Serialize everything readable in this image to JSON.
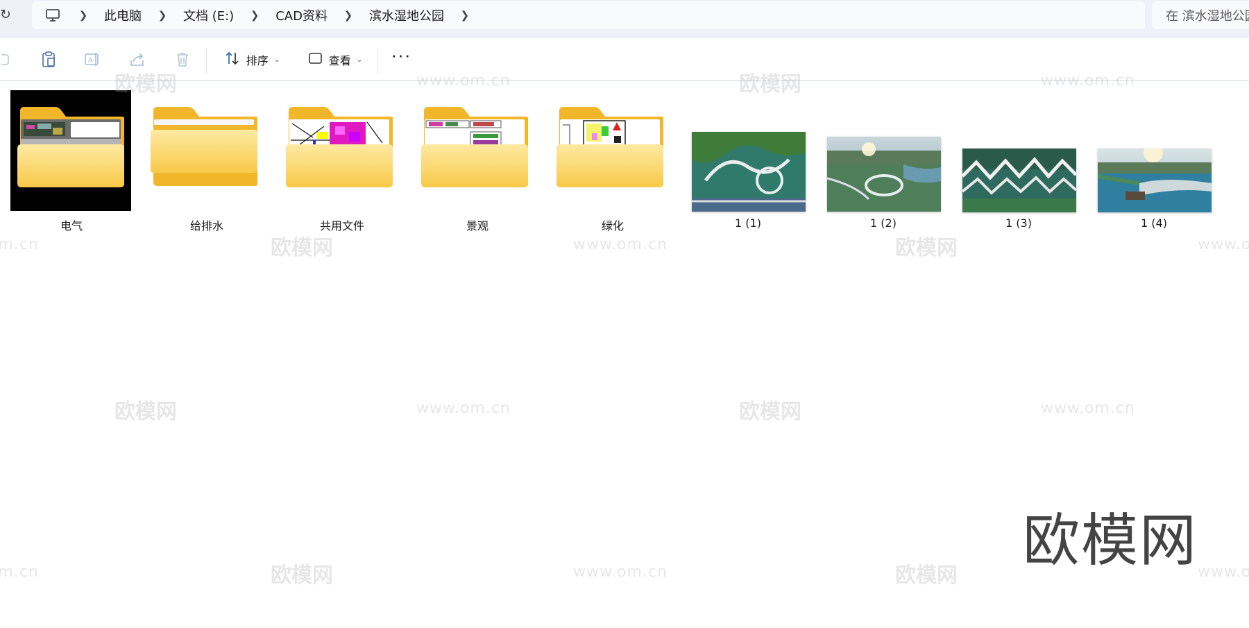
{
  "address_bar": {
    "breadcrumbs": [
      "此电脑",
      "文档 (E:)",
      "CAD资料",
      "滨水湿地公园"
    ],
    "search_placeholder": "在 滨水湿地公园"
  },
  "toolbar": {
    "sort_label": "排序",
    "view_label": "查看",
    "more_label": "···"
  },
  "files": {
    "items": [
      {
        "name": "电气",
        "kind": "folder",
        "selected": true
      },
      {
        "name": "给排水",
        "kind": "folder"
      },
      {
        "name": "共用文件",
        "kind": "folder"
      },
      {
        "name": "景观",
        "kind": "folder"
      },
      {
        "name": "绿化",
        "kind": "folder"
      },
      {
        "name": "1 (1)",
        "kind": "image"
      },
      {
        "name": "1 (2)",
        "kind": "image"
      },
      {
        "name": "1 (3)",
        "kind": "image"
      },
      {
        "name": "1 (4)",
        "kind": "image"
      }
    ]
  },
  "watermark": {
    "brand": "欧模网",
    "url": "www.om.cn"
  },
  "colors": {
    "folder_back": "#f2b62a",
    "folder_front": "#fcd46a",
    "address_bg": "#eef2f8",
    "accent": "#2a6fb5"
  }
}
